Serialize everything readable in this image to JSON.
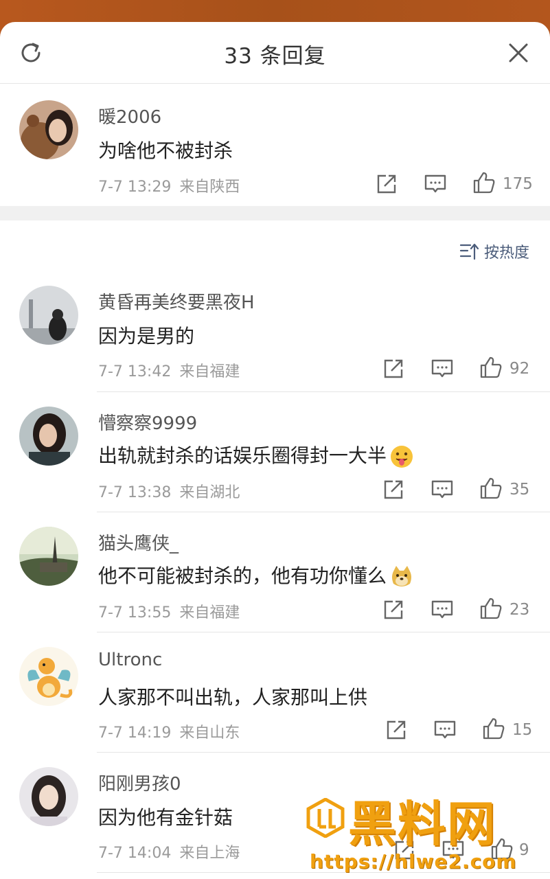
{
  "header": {
    "title": "33 条回复"
  },
  "root_comment": {
    "name": "暖2006",
    "text": "为啥他不被封杀",
    "time": "7-7 13:29",
    "location": "来自陕西",
    "likes": "175"
  },
  "sort": {
    "label": "按热度"
  },
  "replies": [
    {
      "name": "黄昏再美终要黑夜H",
      "text": "因为是男的",
      "time": "7-7 13:42",
      "location": "来自福建",
      "likes": "92"
    },
    {
      "name": "懵察察9999",
      "text": "出轨就封杀的话娱乐圈得封一大半",
      "time": "7-7 13:38",
      "location": "来自湖北",
      "likes": "35"
    },
    {
      "name": "猫头鹰侠_",
      "text": "他不可能被封杀的，他有功你懂么",
      "time": "7-7 13:55",
      "location": "来自福建",
      "likes": "23"
    },
    {
      "name": "Ultronc",
      "text": "人家那不叫出轨，人家那叫上供",
      "time": "7-7 14:19",
      "location": "来自山东",
      "likes": "15"
    },
    {
      "name": "阳刚男孩0",
      "text": "因为他有金针菇",
      "time": "7-7 14:04",
      "location": "来自上海",
      "likes": "9"
    }
  ],
  "watermark": {
    "title": "黑料网",
    "url": "https://hlwe2.com"
  },
  "colors": {
    "accent": "#4b5c7a",
    "watermark": "#f0a010",
    "top_band": "#b8581e"
  },
  "icons": [
    "refresh-icon",
    "close-icon",
    "share-icon",
    "comment-icon",
    "like-icon",
    "sort-icon"
  ]
}
